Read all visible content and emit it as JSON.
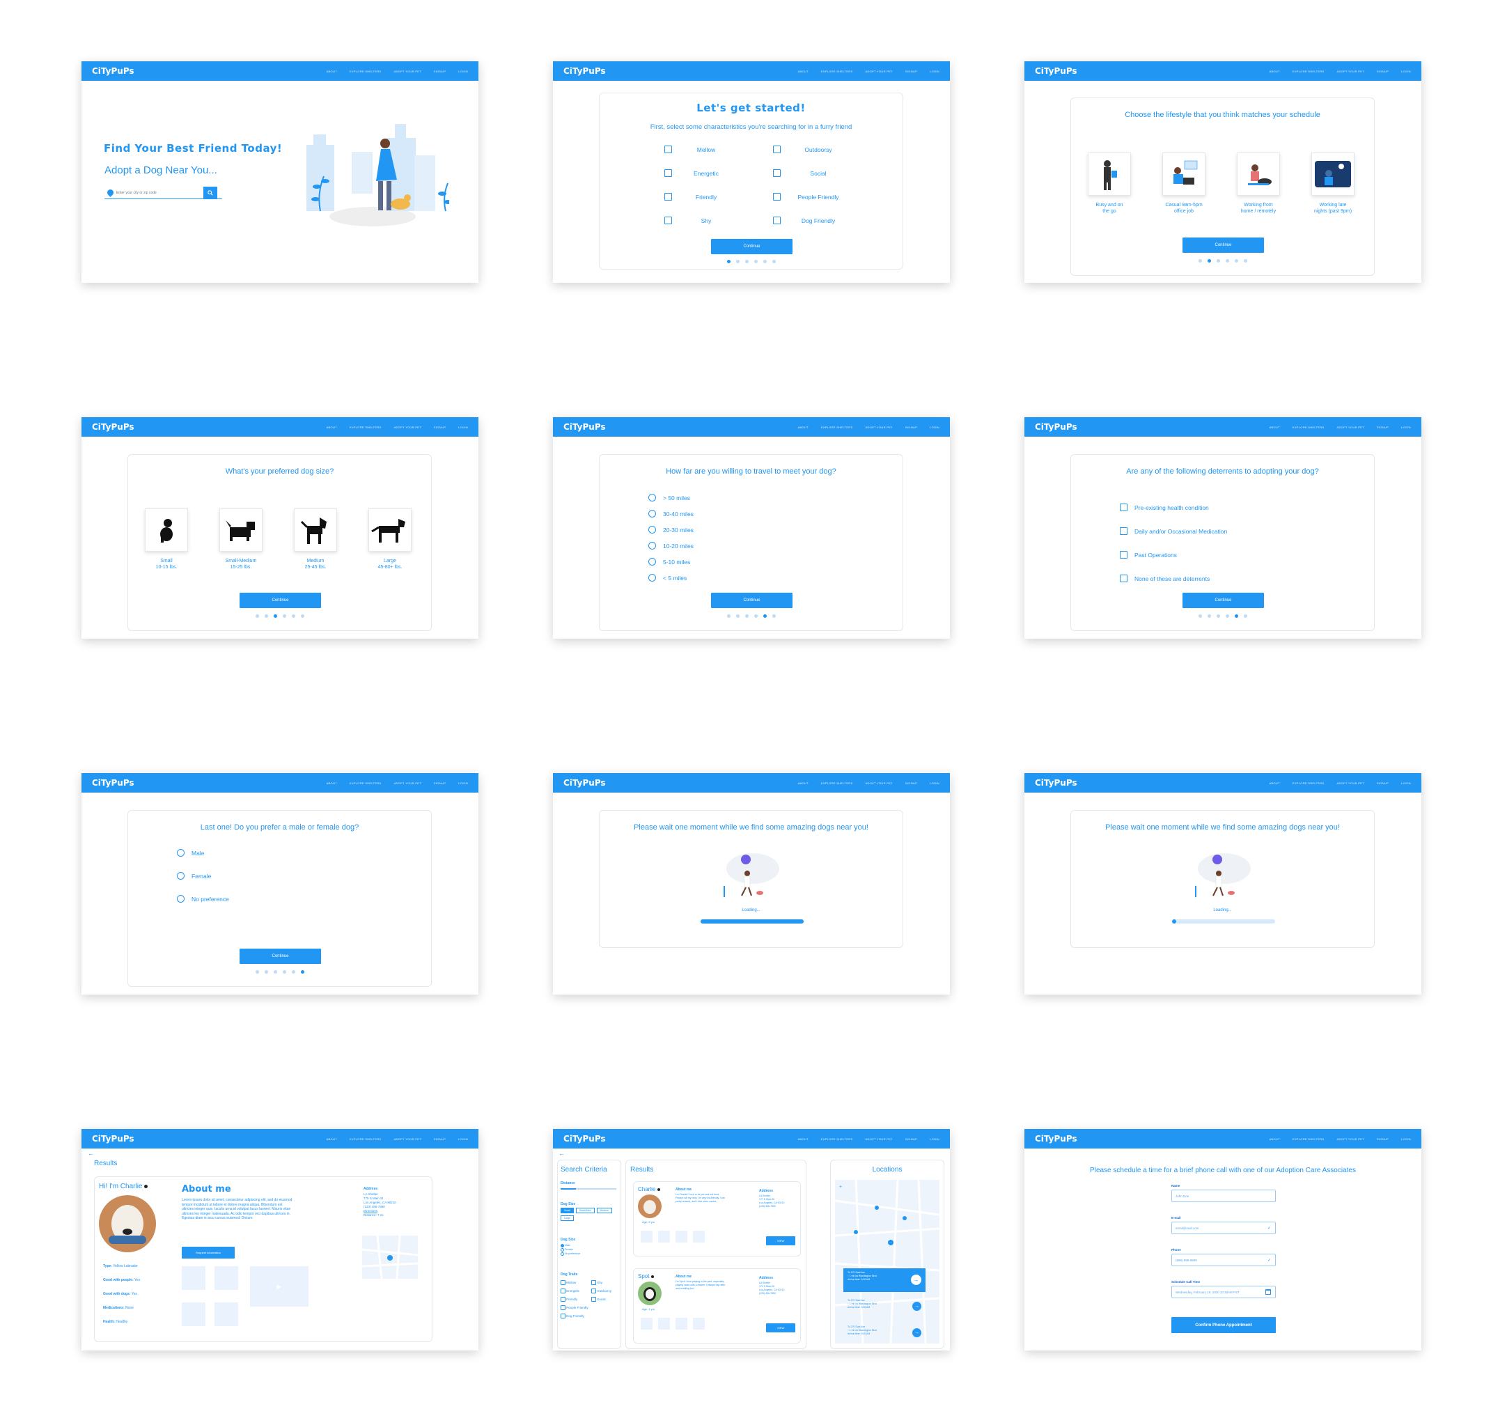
{
  "nav": {
    "logo": "CiTyPuPs",
    "links": [
      "ABOUT",
      "EXPLORE SHELTERS",
      "ADOPT YOUR PET",
      "SIGNUP",
      "LOGIN"
    ]
  },
  "home": {
    "headline": "Find Your Best Friend Today!",
    "subhead": "Adopt a Dog Near You...",
    "search_placeholder": "Enter your city or zip code"
  },
  "common": {
    "continue": "Continue"
  },
  "characteristics": {
    "title": "Let's get started!",
    "subtitle": "First, select some characteristics you're searching for in a furry friend",
    "left": [
      "Mellow",
      "Energetic",
      "Friendly",
      "Shy"
    ],
    "right": [
      "Outdoorsy",
      "Social",
      "People Friendly",
      "Dog Friendly"
    ]
  },
  "lifestyle": {
    "title": "Choose the lifestyle that you think matches your schedule",
    "options": [
      {
        "l1": "Busy and on",
        "l2": "the go"
      },
      {
        "l1": "Casual 9am-5pm",
        "l2": "office job"
      },
      {
        "l1": "Working from",
        "l2": "home / remotely"
      },
      {
        "l1": "Working late",
        "l2": "nights (past 9pm)"
      }
    ]
  },
  "size": {
    "title": "What's your preferred dog size?",
    "options": [
      {
        "l1": "Small",
        "l2": "10-15 lbs."
      },
      {
        "l1": "Small-Medium",
        "l2": "15-25 lbs."
      },
      {
        "l1": "Medium",
        "l2": "25-45 lbs."
      },
      {
        "l1": "Large",
        "l2": "45-80+ lbs."
      }
    ]
  },
  "distance": {
    "title": "How far are you willing to travel to meet your dog?",
    "options": [
      "> 50 miles",
      "30-40 miles",
      "20-30 miles",
      "10-20 miles",
      "5-10 miles",
      "< 5 miles"
    ]
  },
  "deterrents": {
    "title": "Are any of the following deterrents to adopting your dog?",
    "options": [
      "Pre-existing health condition",
      "Daily and/or Occasional Medication",
      "Past Operations",
      "None of these are deterrents"
    ]
  },
  "gender": {
    "title": "Last one! Do you prefer a male or female dog?",
    "options": [
      "Male",
      "Female",
      "No preference"
    ]
  },
  "loading": {
    "title": "Please wait one moment while we find some amazing dogs near you!",
    "label": "Loading...",
    "progress_a": 1.0,
    "progress_b": 0.03
  },
  "profile": {
    "back": "Results",
    "greeting": "Hi! I'm Charlie",
    "about_title": "About me",
    "about_text": "Lorem ipsum dolor sit amet, consectetur adipiscing elit, sed do eiusmod tempor incididunt ut labore et dolore magna aliqua. Bibendum est ultricies integer quis. Iaculis urna id volutpat lacus laoreet. Mauris vitae ultricies leo integer malesuada. Ac odio tempor orci dapibus ultrices in. Egestas diam in arcu cursus euismod. Dictum",
    "request_btn": "Request Information",
    "facts": [
      {
        "k": "Type:",
        "v": "Yellow Labrador"
      },
      {
        "k": "Good with people:",
        "v": "Yes"
      },
      {
        "k": "Good with dogs:",
        "v": "Yes"
      },
      {
        "k": "Medications:",
        "v": "None"
      },
      {
        "k": "Health:",
        "v": "Healthy"
      }
    ],
    "address_title": "Address",
    "address_lines": [
      "LA Shelter",
      "775 S Main St",
      "Los Angeles, CA 90210",
      "(123) 456-7890",
      "Directions",
      "Distance: 7 mi"
    ]
  },
  "results": {
    "criteria_title": "Search Criteria",
    "results_title": "Results",
    "locations_title": "Locations",
    "distance_label": "Distance",
    "size_label": "Dog Size",
    "size_chips": [
      "Small",
      "Small-Med",
      "Medium",
      "Large"
    ],
    "gender_label": "Dog Size",
    "gender_opts": [
      "Male",
      "Female",
      "No preference"
    ],
    "traits_label": "Dog Traits",
    "traits_left": [
      "Mellow",
      "Energetic",
      "Friendly",
      "People Friendly",
      "Dog Friendly"
    ],
    "traits_right": [
      "Shy",
      "Outdoorsy",
      "Social"
    ],
    "dogs": [
      {
        "name": "Charlie",
        "age": "Age: 2 yrs",
        "about": "About me",
        "desc": "I'm Charlie! I love to be pet and eat food. Please rub my belly. I'm very kid-friendly. I am pretty relaxed, and I love other canine",
        "addr_title": "Address",
        "addr": [
          "LA Shelter",
          "177 S Main St",
          "Los Angeles, CA 90210",
          "(123) 456-7890"
        ],
        "view": "VIEW"
      },
      {
        "name": "Spot",
        "age": "Age: 1 yrs",
        "about": "About me",
        "desc": "I'm Spot! I love playing in the park, especially playing catch with a frisbee. I always nap after and cuddling too!",
        "addr_title": "Address",
        "addr": [
          "LA Shelter",
          "171 S Main St",
          "Los Angeles, CA 90210",
          "(123) 456-7890"
        ],
        "view": "VIEW"
      }
    ],
    "routes": [
      {
        "a": "To 270 East Ave",
        "b": "↑ 1 mi via Washington Blvd",
        "c": "Arrival time: 3:00 AM"
      },
      {
        "a": "To 270 East Ave",
        "b": "↑ 1 mi via Washington Blvd",
        "c": "Arrival time: 3:00 AM"
      },
      {
        "a": "To 270 East Ave",
        "b": "↑ 1 mi via Washington Blvd",
        "c": "Arrival time: 3:00 AM"
      }
    ]
  },
  "schedule": {
    "title": "Please schedule a time for a brief phone call with one of our Adoption Care Associates",
    "name_label": "Name",
    "name_value": "John Doe",
    "email_label": "E-mail",
    "email_value": "email@mail.com",
    "phone_label": "Phone",
    "phone_value": "(999) 999-9999",
    "time_label": "Schedule Call Time",
    "time_value": "Wednesday, February 19, 2020 10:30AM PST",
    "confirm": "Confirm Phone Appointment"
  },
  "colors": {
    "brand": "#2196F3",
    "light": "#eaf3fd"
  }
}
